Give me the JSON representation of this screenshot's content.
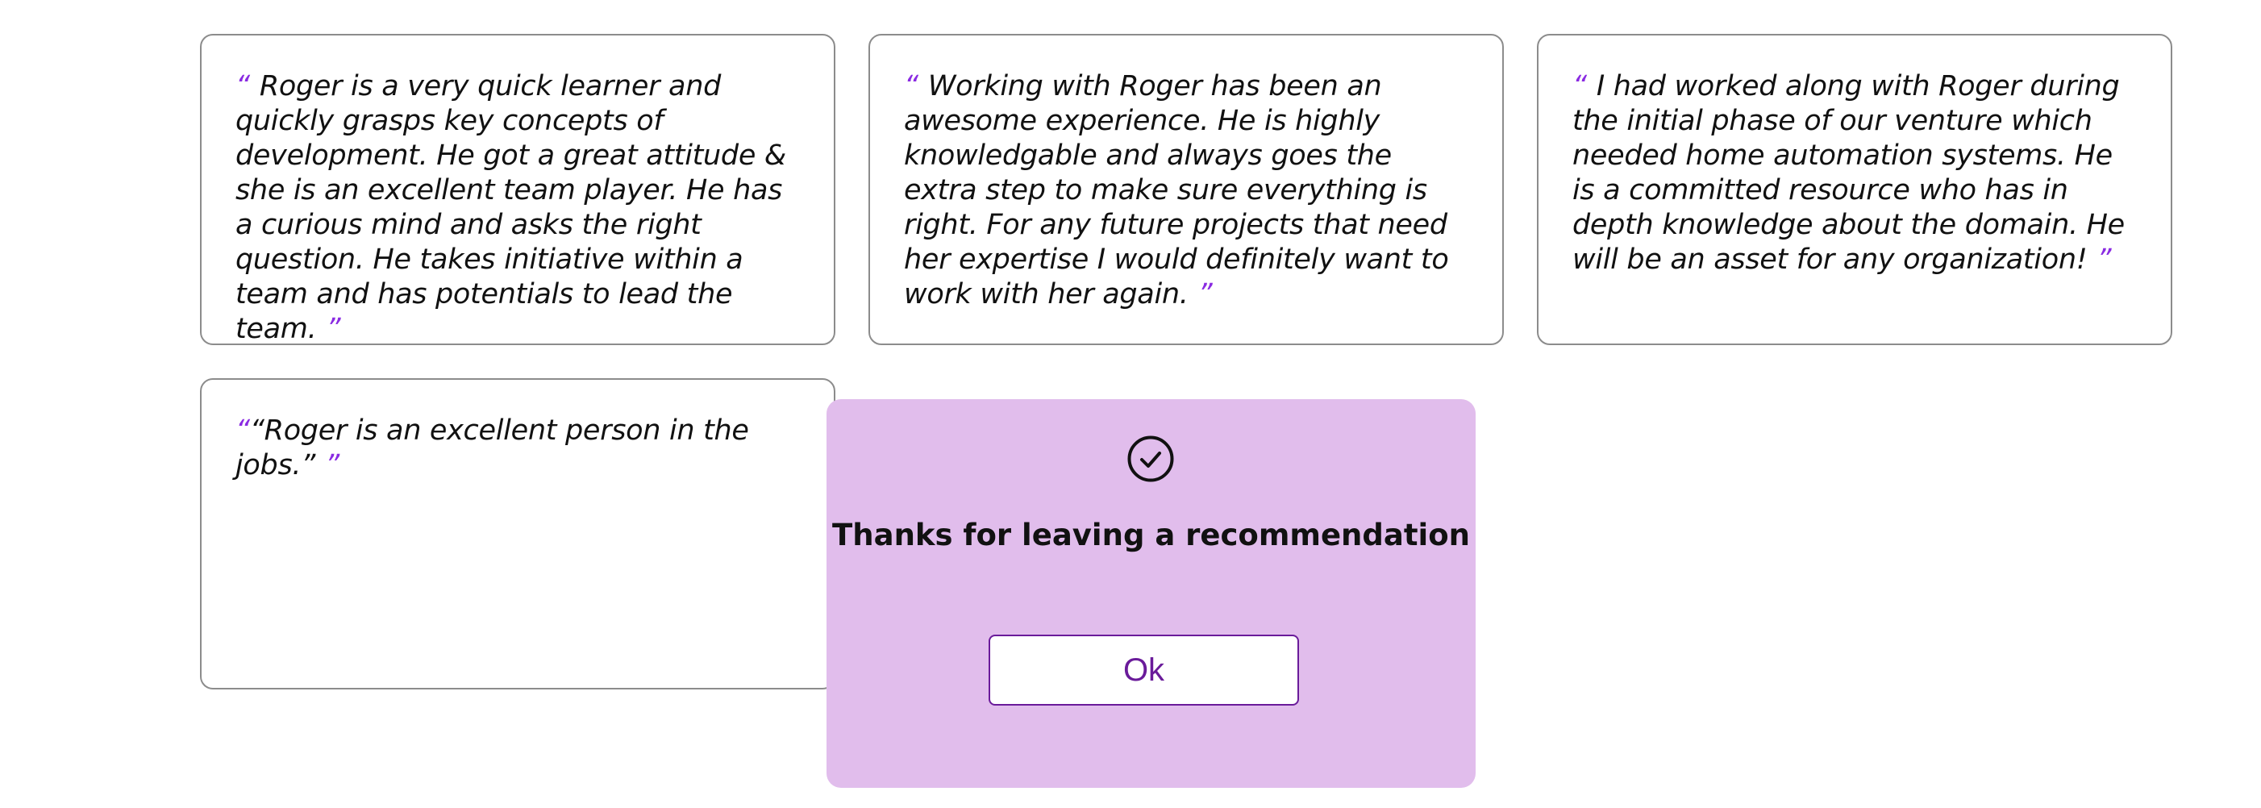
{
  "colors": {
    "quote_mark": "#8a2be2",
    "modal_bg": "#e1bdec",
    "ok_button_text": "#6a1b9a",
    "card_border": "#8c8c8c"
  },
  "quote_open": "“",
  "quote_close": "”",
  "recommendations": [
    {
      "text": "Roger is a very quick learner and quickly grasps key concepts of development. He got a great attitude & she is an excellent team player. He has a curious mind and asks the right question. He takes initiative within a team and has potentials to lead the team."
    },
    {
      "text": "Working with Roger has been an awesome experience. He is highly knowledgable and always goes the extra step to make sure everything is right. For any future projects that need her expertise I would definitely want to work with her again."
    },
    {
      "text": "I had worked along with Roger during the initial phase of our venture which needed home automation systems. He is a committed resource who has in depth knowledge about the domain. He will be an asset for any organization!"
    },
    {
      "text": "“Roger is an excellent person in the jobs.”"
    }
  ],
  "modal": {
    "icon": "check-circle-icon",
    "title": "Thanks for leaving a recommendation",
    "ok_label": "Ok"
  }
}
